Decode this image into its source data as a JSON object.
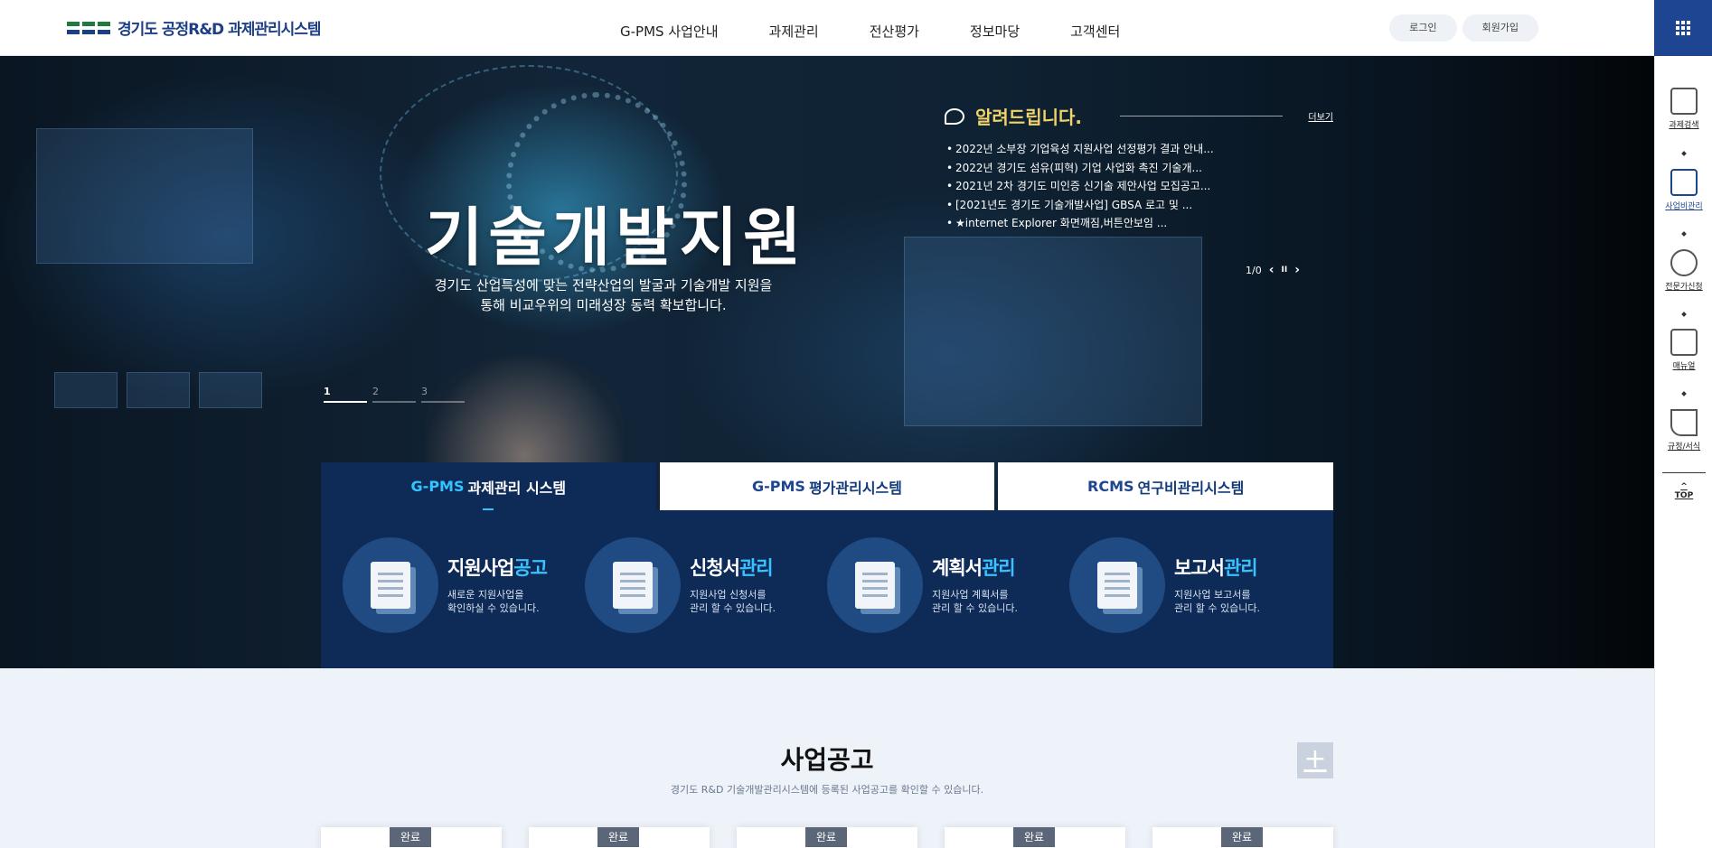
{
  "header": {
    "logo_text": "경기도 공정R&D 과제관리시스템",
    "nav": [
      "G-PMS 사업안내",
      "과제관리",
      "전산평가",
      "정보마당",
      "고객센터"
    ],
    "login_label": "로그인",
    "signup_label": "회원가입"
  },
  "hero": {
    "title": "기술개발지원",
    "subtitle_line1": "경기도 산업특성에 맞는 전략산업의 발굴과 기술개발 지원을",
    "subtitle_line2": "통해 비교우위의 미래성장 동력 확보합니다.",
    "slides": [
      "1",
      "2",
      "3"
    ],
    "active_slide": 1
  },
  "notice": {
    "title": "알려드립니다.",
    "more_label": "더보기",
    "items": [
      "2022년 소부장 기업육성 지원사업 선정평가 결과 안내...",
      "2022년 경기도 섬유(피혁) 기업 사업화 촉진 기술개...",
      "2021년 2차 경기도 미인증 신기술 제안사업 모집공고...",
      "[2021년도 경기도 기술개발사업] GBSA 로고 및 ...",
      "★internet Explorer 화면깨짐,버튼안보임 ..."
    ],
    "pager": "1/0",
    "prev_icon": "‹",
    "pause_icon": "II",
    "next_icon": "›"
  },
  "tabs": [
    {
      "accent": "G-PMS",
      "label": "과제관리 시스템"
    },
    {
      "accent": "G-PMS",
      "label": "평가관리시스템"
    },
    {
      "accent": "RCMS",
      "label": "연구비관리시스템"
    }
  ],
  "cards": [
    {
      "title_a": "지원사업",
      "title_b": "공고",
      "desc1": "새로운 지원사업을",
      "desc2": "확인하실 수 있습니다."
    },
    {
      "title_a": "신청서",
      "title_b": "관리",
      "desc1": "지원사업 신청서를",
      "desc2": "관리 할 수 있습니다."
    },
    {
      "title_a": "계획서",
      "title_b": "관리",
      "desc1": "지원사업 계획서를",
      "desc2": "관리 할 수 있습니다."
    },
    {
      "title_a": "보고서",
      "title_b": "관리",
      "desc1": "지원사업 보고서를",
      "desc2": "관리 할 수 있습니다."
    }
  ],
  "business": {
    "title": "사업공고",
    "subtitle": "경기도 R&D 기술개발관리시스템에 등록된 사업공고를 확인할 수 있습니다.",
    "plus_label": "+",
    "badges": [
      "완료",
      "완료",
      "완료",
      "완료",
      "완료"
    ]
  },
  "quick_menu": {
    "items": [
      "과제검색",
      "사업비관리",
      "전문가신청",
      "매뉴얼",
      "규정/서식"
    ],
    "active_index": 1,
    "top_label": "TOP",
    "top_arrow": "^"
  },
  "colors": {
    "brand_navy": "#0e2b58",
    "brand_blue": "#1d4591",
    "accent_cyan": "#39c2ff",
    "notice_yellow": "#f1d36a"
  }
}
